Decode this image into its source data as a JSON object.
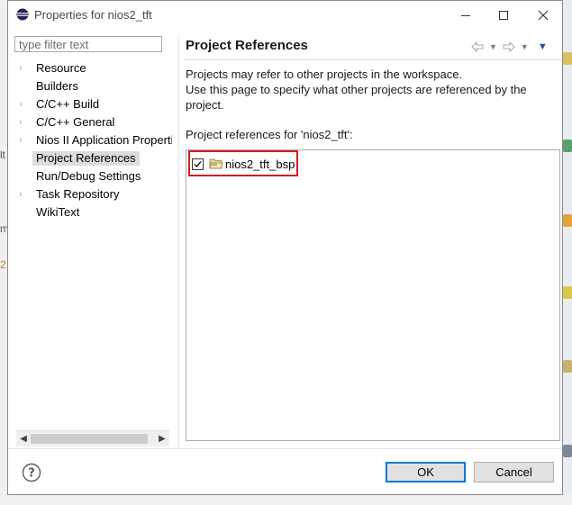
{
  "window": {
    "title": "Properties for nios2_tft",
    "app_icon": "eclipse-icon",
    "controls": {
      "minimize": "minimize-icon",
      "maximize": "maximize-icon",
      "close": "close-icon"
    }
  },
  "left": {
    "filter_placeholder": "type filter text",
    "items": [
      {
        "label": "Resource",
        "expandable": true
      },
      {
        "label": "Builders",
        "expandable": false
      },
      {
        "label": "C/C++ Build",
        "expandable": true
      },
      {
        "label": "C/C++ General",
        "expandable": true
      },
      {
        "label": "Nios II Application Properties",
        "expandable": true
      },
      {
        "label": "Project References",
        "expandable": false,
        "selected": true
      },
      {
        "label": "Run/Debug Settings",
        "expandable": false
      },
      {
        "label": "Task Repository",
        "expandable": true
      },
      {
        "label": "WikiText",
        "expandable": false
      }
    ]
  },
  "right": {
    "title": "Project References",
    "nav_icons": [
      "back-arrow-icon",
      "dropdown-icon",
      "forward-arrow-icon",
      "dropdown-icon",
      "view-menu-icon"
    ],
    "description_line1": "Projects may refer to other projects in the workspace.",
    "description_line2": "Use this page to specify what other projects are referenced by the project.",
    "refs_label": "Project references for 'nios2_tft':",
    "references": [
      {
        "name": "nios2_tft_bsp",
        "checked": true,
        "icon": "open-project-folder-icon"
      }
    ],
    "highlight_color": "#d51d1d"
  },
  "footer": {
    "help_icon": "help-icon",
    "ok_label": "OK",
    "cancel_label": "Cancel"
  },
  "background": {
    "fragments": [
      "lt",
      "m",
      "2"
    ]
  }
}
